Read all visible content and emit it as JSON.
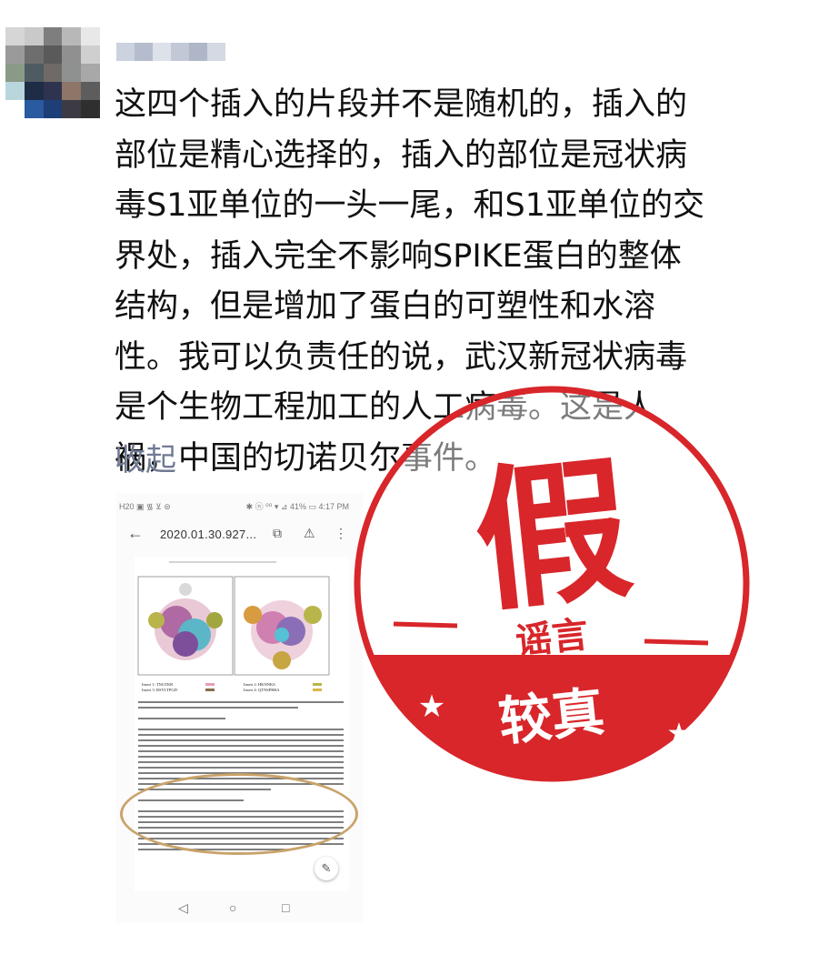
{
  "post": {
    "author_name": "",
    "lines": [
      "这四个插入的片段并不是随机的，插入的",
      "部位是精心选择的，插入的部位是冠状病",
      "毒S1亚单位的一头一尾，和S1亚单位的交",
      "界处，插入完全不影响SPIKE蛋白的整体",
      "结构，但是增加了蛋白的可塑性和水溶",
      "性。我可以负责任的说，武汉新冠状病毒",
      "是个生物工程加工的人工病毒。这是人",
      "祸，中国的切诺贝尔事件。"
    ],
    "collapse_label": "收起"
  },
  "screenshot": {
    "status_left": "H20 ▣ ᯾ ⊻ ⊜",
    "status_right": "✱ ⓝ ⁰⁰ ▾ ⊿ 41% ▭ 4:17 PM",
    "url": "2020.01.30.927...",
    "back_icon": "←",
    "icons": [
      "⧉",
      "⚠",
      "⋮"
    ],
    "nav": [
      "◁",
      "○",
      "□"
    ],
    "pencil_icon": "✎",
    "figure_captions": [
      "Insert 1: TNGTKR",
      "Insert 2: HKNNKS",
      "Insert 3: RSYLTPGD",
      "Insert 4: QTNSPRRA"
    ]
  },
  "stamp": {
    "big_char": "假",
    "label": "谣言",
    "brand": "较真",
    "color": "#d8262a"
  }
}
